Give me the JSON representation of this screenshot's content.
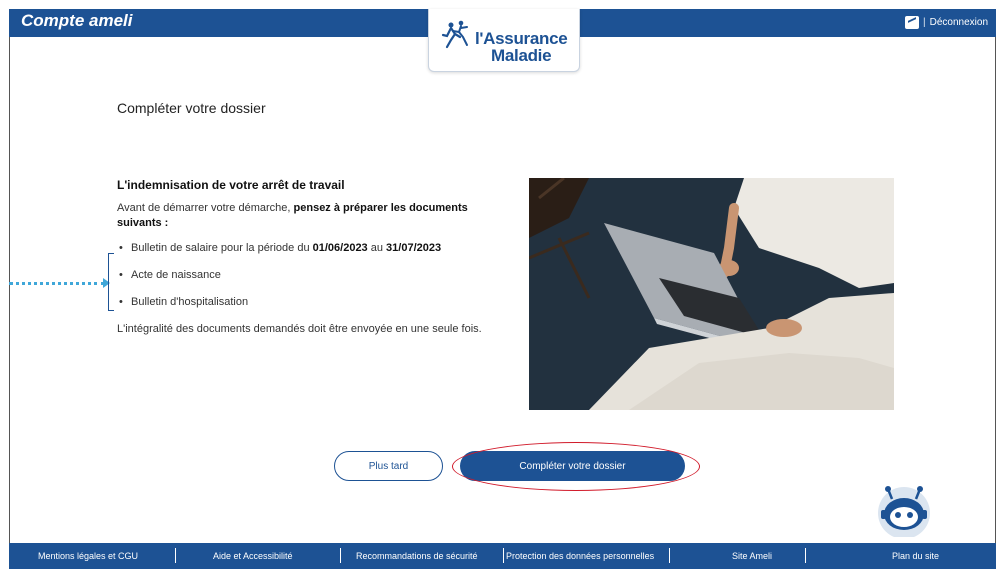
{
  "header": {
    "app_title": "Compte ameli",
    "logout_label": "Déconnexion",
    "logout_separator": "|",
    "logo_line1": "l'Assurance",
    "logo_line2": "Maladie"
  },
  "main": {
    "page_title": "Compléter votre dossier",
    "section_title": "L'indemnisation de votre arrêt de travail",
    "intro_text": "Avant de démarrer votre démarche,",
    "intro_bold": "pensez à préparer les documents suivants :",
    "documents": [
      {
        "text": "Bulletin de salaire pour la période du ",
        "date_from": "01/06/2023",
        "connector": " au ",
        "date_to": "31/07/2023"
      },
      {
        "text": "Acte de naissance"
      },
      {
        "text": "Bulletin d'hospitalisation"
      }
    ],
    "closing_text": "L'intégralité des documents demandés doit être envoyée en une seule fois."
  },
  "actions": {
    "later_label": "Plus tard",
    "complete_label": "Compléter votre dossier"
  },
  "footer": {
    "links": [
      "Mentions légales et CGU",
      "Aide et Accessibilité",
      "Recommandations de sécurité",
      "Protection des données personnelles",
      "Site Ameli",
      "Plan du site"
    ]
  },
  "colors": {
    "brand_blue": "#1d5294",
    "annotation_red": "#d11a2a",
    "annotation_arrow": "#3fa7d9"
  }
}
